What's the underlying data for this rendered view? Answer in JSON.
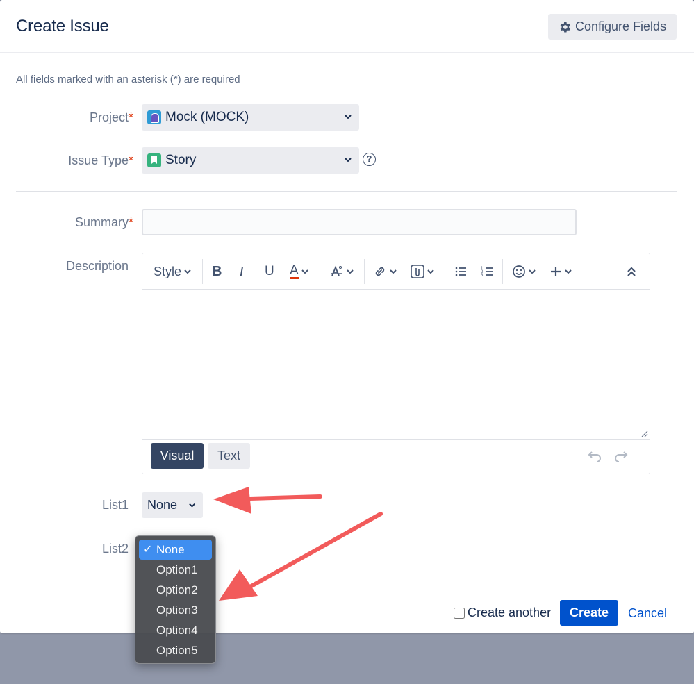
{
  "dialog": {
    "title": "Create Issue",
    "configure_label": "Configure Fields",
    "required_note": "All fields marked with an asterisk (*) are required"
  },
  "fields": {
    "project_label": "Project",
    "project_value": "Mock (MOCK)",
    "issue_type_label": "Issue Type",
    "issue_type_value": "Story",
    "summary_label": "Summary",
    "summary_value": "",
    "description_label": "Description",
    "list1_label": "List1",
    "list1_value": "None",
    "list2_label": "List2"
  },
  "editor": {
    "style_label": "Style",
    "visual_label": "Visual",
    "text_label": "Text"
  },
  "dropdown": {
    "options": [
      "None",
      "Option1",
      "Option2",
      "Option3",
      "Option4",
      "Option5"
    ],
    "selected": "None",
    "check": "✓"
  },
  "footer": {
    "create_another_label": "Create another",
    "create_label": "Create",
    "cancel_label": "Cancel"
  },
  "colors": {
    "primary": "#0052cc",
    "visual_active": "#344563",
    "required_asterisk": "#de350b",
    "annotation_arrow": "#f25b5b",
    "dropdown_highlight": "#3f8ef0"
  }
}
